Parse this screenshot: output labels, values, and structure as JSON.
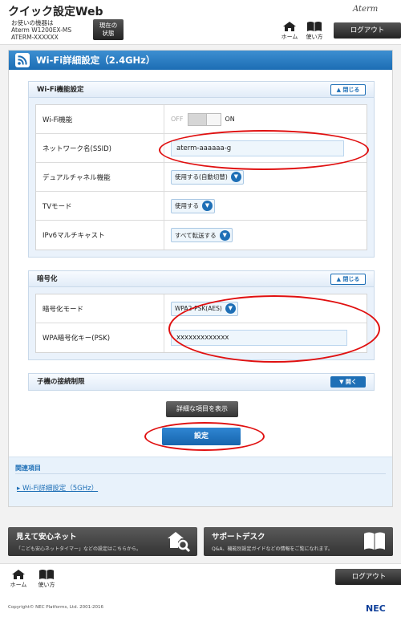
{
  "header": {
    "title": "クイック設定Web",
    "device_label": "お使いの機器は",
    "device_model": "Aterm W1200EX-MS",
    "device_id": "ATERM-XXXXXX",
    "status_label_1": "現在の",
    "status_label_2": "状態",
    "brand": "Aterm",
    "home_label": "ホーム",
    "help_label": "使い方",
    "logout_label": "ログアウト"
  },
  "page": {
    "title": "Wi-Fi詳細設定（2.4GHz）"
  },
  "wifi_section": {
    "title": "Wi-Fi機能設定",
    "toggle_label": "閉じる",
    "rows": [
      {
        "label": "Wi-Fi機能",
        "off": "OFF",
        "on": "ON"
      },
      {
        "label": "ネットワーク名(SSID)",
        "value": "aterm-aaaaaa-g"
      },
      {
        "label": "デュアルチャネル機能",
        "value": "使用する(自動切替)"
      },
      {
        "label": "TVモード",
        "value": "使用する"
      },
      {
        "label": "IPv6マルチキャスト",
        "value": "すべて転送する"
      }
    ]
  },
  "enc_section": {
    "title": "暗号化",
    "toggle_label": "閉じる",
    "rows": [
      {
        "label": "暗号化モード",
        "value": "WPA2-PSK(AES)"
      },
      {
        "label": "WPA暗号化キー(PSK)",
        "value": "xxxxxxxxxxxxx"
      }
    ]
  },
  "child_section": {
    "title": "子機の接続制限",
    "toggle_label": "開く"
  },
  "buttons": {
    "detail": "詳細な項目を表示",
    "set": "設定"
  },
  "related": {
    "title": "関連項目",
    "link": "Wi-Fi詳細設定（5GHz）"
  },
  "promos": [
    {
      "title": "見えて安心ネット",
      "desc": "「こども安心ネットタイマー」などの設定はこちらから。"
    },
    {
      "title": "サポートデスク",
      "desc": "Q&A、機能別設定ガイドなどの情報をご覧になれます。"
    }
  ],
  "footer": {
    "home_label": "ホーム",
    "help_label": "使い方",
    "logout_label": "ログアウト",
    "copyright": "Copyright© NEC Platforms, Ltd. 2001-2016",
    "logo": "NEC"
  }
}
